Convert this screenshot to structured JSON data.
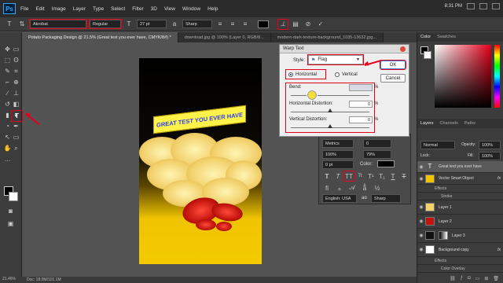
{
  "app": {
    "logo": "Ps"
  },
  "menu": [
    "File",
    "Edit",
    "Image",
    "Layer",
    "Type",
    "Select",
    "Filter",
    "3D",
    "View",
    "Window",
    "Help"
  ],
  "system": {
    "time": "8:31 PM"
  },
  "options": {
    "font_family": "Akrobat",
    "font_style": "Regular",
    "font_size": "27 pt",
    "antialias": "Sharp",
    "warp_icon": "warp-text-icon",
    "commit_icon": "check-icon",
    "cancel_icon": "cancel-icon"
  },
  "tabs": [
    {
      "label": "Potato Packaging Design @ 21.5% (Great test you ever have, CMYK/8#) *"
    },
    {
      "label": "download.jpg @ 100% (Layer 0, RGB/8..."
    },
    {
      "label": "modern-dark-texture-background_1035-13632.jpg..."
    }
  ],
  "canvas": {
    "banner_text": "GREAT TEST YOU EVER HAVE"
  },
  "dialog": {
    "title": "Warp Text",
    "style_label": "Style:",
    "style_value": "Flag",
    "ok": "OK",
    "cancel": "Cancel",
    "horizontal": "Horizontal",
    "vertical": "Vertical",
    "bend_label": "Bend:",
    "bend_value": "",
    "hdist_label": "Horizontal Distortion:",
    "hdist_value": "0",
    "vdist_label": "Vertical Distortion:",
    "vdist_value": "0",
    "pct": "%"
  },
  "character_panel": {
    "metrics": "Metrics",
    "tracking": "0",
    "vscale": "100%",
    "hscale": "79%",
    "baseline": "0 pt",
    "color_label": "Color:",
    "language": "English: USA",
    "aa": "Sharp",
    "aa_label": "aɑ"
  },
  "panels": {
    "top_tabs": [
      "Color",
      "Swatches"
    ],
    "layer_tabs": [
      "Layers",
      "Channels",
      "Paths"
    ],
    "kind": "Normal",
    "opacity_label": "Opacity:",
    "opacity": "100%",
    "fill_label": "Fill:",
    "fill": "100%",
    "lock_label": "Lock:"
  },
  "layers": [
    {
      "name": "Great test you ever have",
      "type": "text",
      "selected": true
    },
    {
      "name": "Vector Smart Object",
      "type": "smart"
    },
    {
      "name": "Effects",
      "type": "sub"
    },
    {
      "name": "Stroke",
      "type": "sub"
    },
    {
      "name": "Layer 1",
      "type": "img"
    },
    {
      "name": "Layer 2",
      "type": "img"
    },
    {
      "name": "Layer 3",
      "type": "img"
    },
    {
      "name": "Background copy",
      "type": "img"
    },
    {
      "name": "Effects",
      "type": "sub"
    },
    {
      "name": "Color Overlay",
      "type": "sub"
    }
  ],
  "status": {
    "zoom": "21.46%",
    "doc": "Doc: 18.0M/101.1M"
  },
  "colors": {
    "highlight": "#e3001b",
    "accent": "#31a8ff",
    "banner_text": "#2b3df2"
  }
}
